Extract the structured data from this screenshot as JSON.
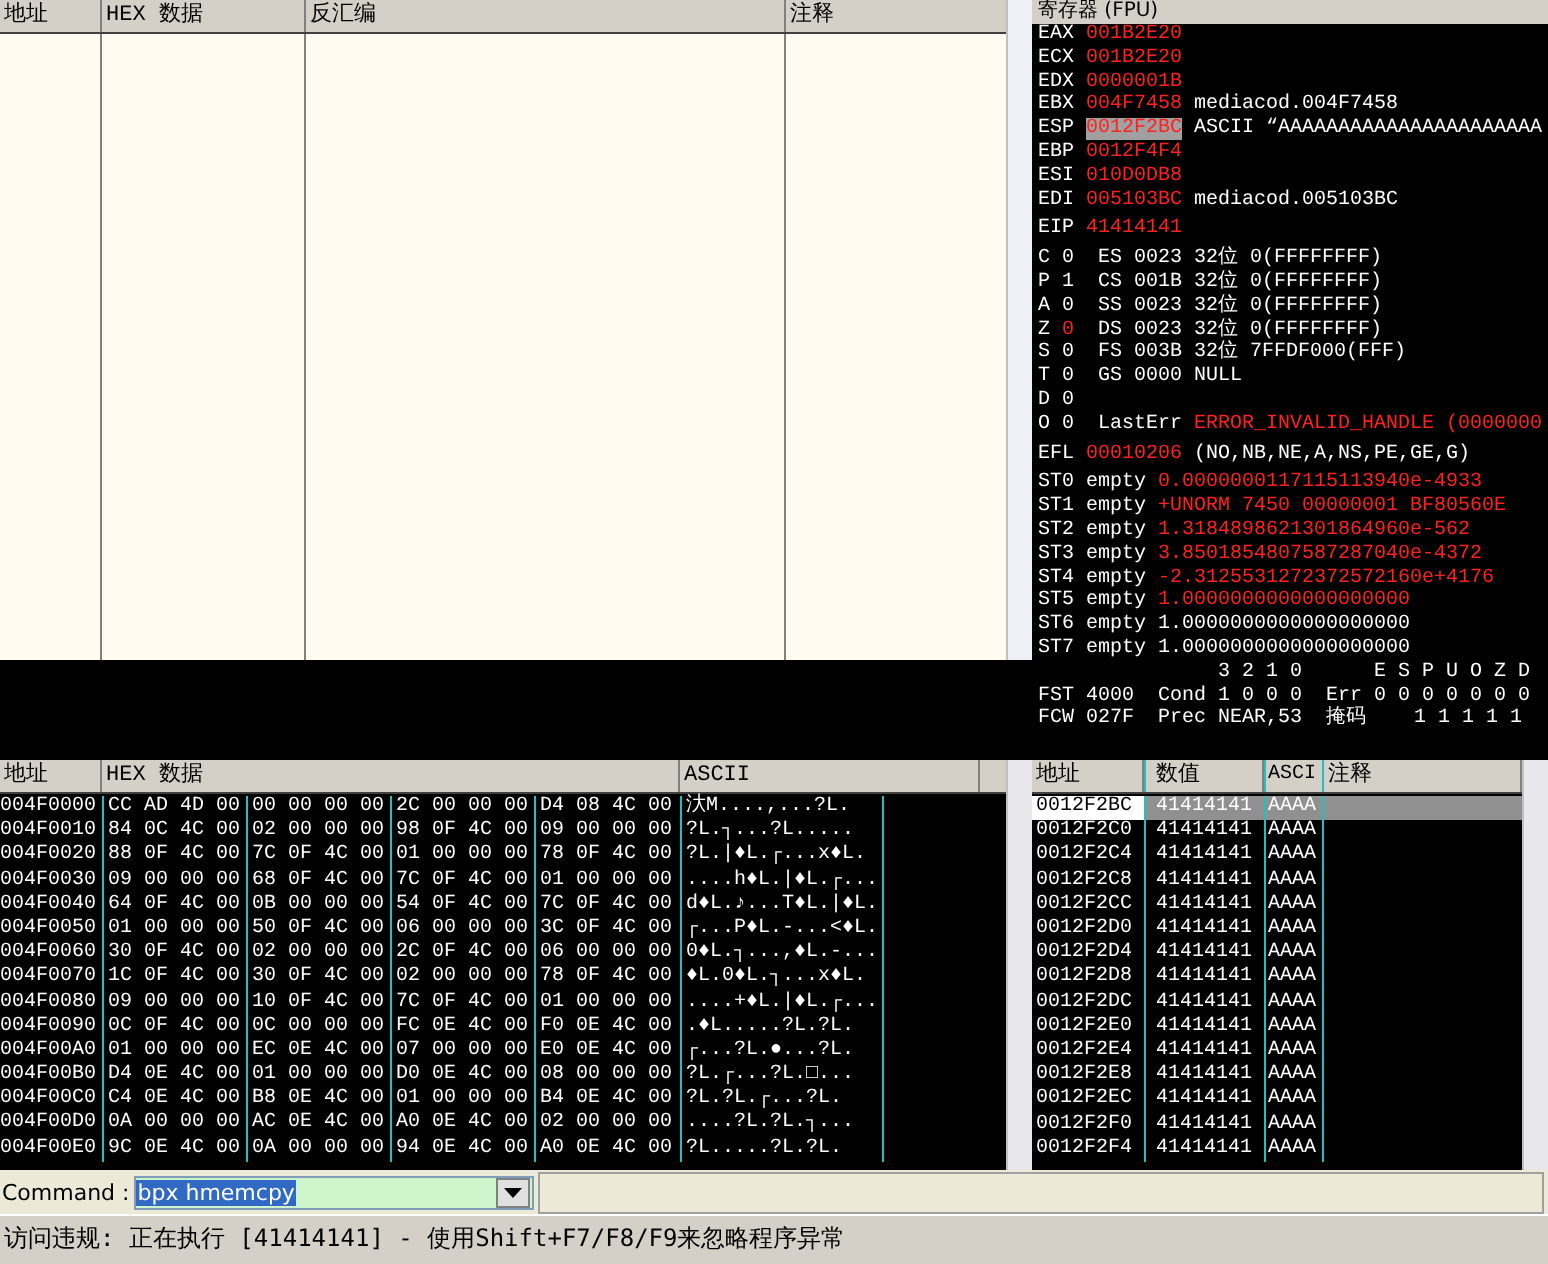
{
  "disassembly": {
    "columns": [
      "地址",
      "HEX 数据",
      "反汇编",
      "注释"
    ]
  },
  "registers": {
    "title": "寄存器 (FPU)",
    "groups": [
      {
        "lines": [
          [
            {
              "text": "EAX ",
              "kind": "normal"
            },
            {
              "text": "001B2E20",
              "kind": "changed"
            }
          ],
          [
            {
              "text": "ECX ",
              "kind": "normal"
            },
            {
              "text": "001B2E20",
              "kind": "changed"
            }
          ],
          [
            {
              "text": "EDX ",
              "kind": "normal"
            },
            {
              "text": "0000001B",
              "kind": "changed"
            }
          ],
          [
            {
              "text": "EBX ",
              "kind": "normal"
            },
            {
              "text": "004F7458",
              "kind": "changed"
            },
            {
              "text": " mediacod.004F7458",
              "kind": "normal"
            }
          ],
          [
            {
              "text": "ESP ",
              "kind": "normal"
            },
            {
              "text": "0012F2BC",
              "kind": "selected"
            },
            {
              "text": " ASCII “AAAAAAAAAAAAAAAAAAAAAA",
              "kind": "normal"
            }
          ],
          [
            {
              "text": "EBP ",
              "kind": "normal"
            },
            {
              "text": "0012F4F4",
              "kind": "changed"
            }
          ],
          [
            {
              "text": "ESI ",
              "kind": "normal"
            },
            {
              "text": "010D0DB8",
              "kind": "changed"
            }
          ],
          [
            {
              "text": "EDI ",
              "kind": "normal"
            },
            {
              "text": "005103BC",
              "kind": "changed"
            },
            {
              "text": " mediacod.005103BC",
              "kind": "normal"
            }
          ]
        ]
      },
      {
        "lines": [
          [
            {
              "text": "EIP ",
              "kind": "normal"
            },
            {
              "text": "41414141",
              "kind": "changed"
            }
          ]
        ]
      },
      {
        "lines": [
          [
            {
              "text": "C 0  ES 0023 32位 0(FFFFFFFF)",
              "kind": "normal"
            }
          ],
          [
            {
              "text": "P 1  CS 001B 32位 0(FFFFFFFF)",
              "kind": "normal"
            }
          ],
          [
            {
              "text": "A 0  SS 0023 32位 0(FFFFFFFF)",
              "kind": "normal"
            }
          ],
          [
            {
              "text": "Z ",
              "kind": "normal"
            },
            {
              "text": "0",
              "kind": "changed"
            },
            {
              "text": "  DS 0023 32位 0(FFFFFFFF)",
              "kind": "normal"
            }
          ],
          [
            {
              "text": "S 0  FS 003B 32位 7FFDF000(FFF)",
              "kind": "normal"
            }
          ],
          [
            {
              "text": "T 0  GS 0000 NULL",
              "kind": "normal"
            }
          ],
          [
            {
              "text": "D 0",
              "kind": "normal"
            }
          ],
          [
            {
              "text": "O 0  LastErr ",
              "kind": "normal"
            },
            {
              "text": "ERROR_INVALID_HANDLE (0000000",
              "kind": "changed"
            }
          ]
        ]
      },
      {
        "lines": [
          [
            {
              "text": "EFL ",
              "kind": "normal"
            },
            {
              "text": "00010206",
              "kind": "changed"
            },
            {
              "text": " (NO,NB,NE,A,NS,PE,GE,G)",
              "kind": "normal"
            }
          ]
        ]
      },
      {
        "lines": [
          [
            {
              "text": "ST0 empty ",
              "kind": "normal"
            },
            {
              "text": "0.0000000117115113940e-4933",
              "kind": "changed"
            }
          ],
          [
            {
              "text": "ST1 empty ",
              "kind": "normal"
            },
            {
              "text": "+UNORM 7450 00000001 BF80560E",
              "kind": "changed"
            }
          ],
          [
            {
              "text": "ST2 empty ",
              "kind": "normal"
            },
            {
              "text": "1.3184898621301864960e-562",
              "kind": "changed"
            }
          ],
          [
            {
              "text": "ST3 empty ",
              "kind": "normal"
            },
            {
              "text": "3.8501854807587287040e-4372",
              "kind": "changed"
            }
          ],
          [
            {
              "text": "ST4 empty ",
              "kind": "normal"
            },
            {
              "text": "-2.3125531272372572160e+4176",
              "kind": "changed"
            }
          ],
          [
            {
              "text": "ST5 empty ",
              "kind": "normal"
            },
            {
              "text": "1.0000000000000000000",
              "kind": "changed"
            }
          ],
          [
            {
              "text": "ST6 empty 1.0000000000000000000",
              "kind": "normal"
            }
          ],
          [
            {
              "text": "ST7 empty 1.0000000000000000000",
              "kind": "normal"
            }
          ],
          [
            {
              "text": "               3 2 1 0      E S P U O Z D",
              "kind": "normal"
            }
          ],
          [
            {
              "text": "FST 4000  Cond 1 0 0 0  Err 0 0 0 0 0 0 0",
              "kind": "normal"
            }
          ],
          [
            {
              "text": "FCW 027F  Prec NEAR,53  掩码    1 1 1 1 1",
              "kind": "normal"
            }
          ]
        ]
      }
    ]
  },
  "dump": {
    "columns": [
      "地址",
      "HEX 数据",
      "ASCII"
    ],
    "rows": [
      {
        "address": "004F0000",
        "hex": [
          "CC AD 4D 00",
          "00 00 00 00",
          "2C 00 00 00",
          "D4 08 4C 00"
        ],
        "ascii": "汏M....,...?L."
      },
      {
        "address": "004F0010",
        "hex": [
          "84 0C 4C 00",
          "02 00 00 00",
          "98 0F 4C 00",
          "09 00 00 00"
        ],
        "ascii": "?L.┐...?L....."
      },
      {
        "address": "004F0020",
        "hex": [
          "88 0F 4C 00",
          "7C 0F 4C 00",
          "01 00 00 00",
          "78 0F 4C 00"
        ],
        "ascii": "?L.|♦L.┌...x♦L."
      },
      {
        "address": "004F0030",
        "hex": [
          "09 00 00 00",
          "68 0F 4C 00",
          "7C 0F 4C 00",
          "01 00 00 00"
        ],
        "ascii": "....h♦L.|♦L.┌..."
      },
      {
        "address": "004F0040",
        "hex": [
          "64 0F 4C 00",
          "0B 00 00 00",
          "54 0F 4C 00",
          "7C 0F 4C 00"
        ],
        "ascii": "d♦L.♪...T♦L.|♦L."
      },
      {
        "address": "004F0050",
        "hex": [
          "01 00 00 00",
          "50 0F 4C 00",
          "06 00 00 00",
          "3C 0F 4C 00"
        ],
        "ascii": "┌...P♦L.-...<♦L."
      },
      {
        "address": "004F0060",
        "hex": [
          "30 0F 4C 00",
          "02 00 00 00",
          "2C 0F 4C 00",
          "06 00 00 00"
        ],
        "ascii": "0♦L.┐...,♦L.-..."
      },
      {
        "address": "004F0070",
        "hex": [
          "1C 0F 4C 00",
          "30 0F 4C 00",
          "02 00 00 00",
          "78 0F 4C 00"
        ],
        "ascii": "♦L.0♦L.┐...x♦L."
      },
      {
        "address": "004F0080",
        "hex": [
          "09 00 00 00",
          "10 0F 4C 00",
          "7C 0F 4C 00",
          "01 00 00 00"
        ],
        "ascii": "....+♦L.|♦L.┌..."
      },
      {
        "address": "004F0090",
        "hex": [
          "0C 0F 4C 00",
          "0C 00 00 00",
          "FC 0E 4C 00",
          "F0 0E 4C 00"
        ],
        "ascii": ".♦L.....?L.?L."
      },
      {
        "address": "004F00A0",
        "hex": [
          "01 00 00 00",
          "EC 0E 4C 00",
          "07 00 00 00",
          "E0 0E 4C 00"
        ],
        "ascii": "┌...?L.●...?L."
      },
      {
        "address": "004F00B0",
        "hex": [
          "D4 0E 4C 00",
          "01 00 00 00",
          "D0 0E 4C 00",
          "08 00 00 00"
        ],
        "ascii": "?L.┌...?L.□..."
      },
      {
        "address": "004F00C0",
        "hex": [
          "C4 0E 4C 00",
          "B8 0E 4C 00",
          "01 00 00 00",
          "B4 0E 4C 00"
        ],
        "ascii": "?L.?L.┌...?L."
      },
      {
        "address": "004F00D0",
        "hex": [
          "0A 00 00 00",
          "AC 0E 4C 00",
          "A0 0E 4C 00",
          "02 00 00 00"
        ],
        "ascii": "....?L.?L.┐..."
      },
      {
        "address": "004F00E0",
        "hex": [
          "9C 0E 4C 00",
          "0A 00 00 00",
          "94 0E 4C 00",
          "A0 0E 4C 00"
        ],
        "ascii": "?L.....?L.?L."
      }
    ]
  },
  "stack": {
    "columns": [
      "地址",
      "数值",
      "ASCI",
      "注释"
    ],
    "rows": [
      {
        "address": "0012F2BC",
        "value": "41414141",
        "ascii": "AAAA",
        "selected": true
      },
      {
        "address": "0012F2C0",
        "value": "41414141",
        "ascii": "AAAA",
        "selected": false
      },
      {
        "address": "0012F2C4",
        "value": "41414141",
        "ascii": "AAAA",
        "selected": false
      },
      {
        "address": "0012F2C8",
        "value": "41414141",
        "ascii": "AAAA",
        "selected": false
      },
      {
        "address": "0012F2CC",
        "value": "41414141",
        "ascii": "AAAA",
        "selected": false
      },
      {
        "address": "0012F2D0",
        "value": "41414141",
        "ascii": "AAAA",
        "selected": false
      },
      {
        "address": "0012F2D4",
        "value": "41414141",
        "ascii": "AAAA",
        "selected": false
      },
      {
        "address": "0012F2D8",
        "value": "41414141",
        "ascii": "AAAA",
        "selected": false
      },
      {
        "address": "0012F2DC",
        "value": "41414141",
        "ascii": "AAAA",
        "selected": false
      },
      {
        "address": "0012F2E0",
        "value": "41414141",
        "ascii": "AAAA",
        "selected": false
      },
      {
        "address": "0012F2E4",
        "value": "41414141",
        "ascii": "AAAA",
        "selected": false
      },
      {
        "address": "0012F2E8",
        "value": "41414141",
        "ascii": "AAAA",
        "selected": false
      },
      {
        "address": "0012F2EC",
        "value": "41414141",
        "ascii": "AAAA",
        "selected": false
      },
      {
        "address": "0012F2F0",
        "value": "41414141",
        "ascii": "AAAA",
        "selected": false
      },
      {
        "address": "0012F2F4",
        "value": "41414141",
        "ascii": "AAAA",
        "selected": false
      }
    ]
  },
  "command": {
    "label": "Command :",
    "value": "bpx hmemcpy"
  },
  "status_bar": "访问违规: 正在执行 [41414141] - 使用Shift+F7/F8/F9来忽略程序异常"
}
